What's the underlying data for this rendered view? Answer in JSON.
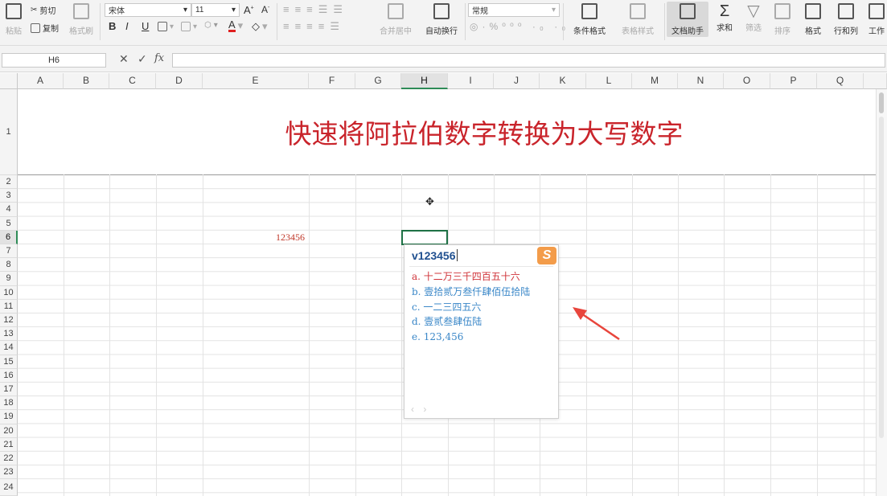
{
  "ribbon": {
    "clipboard": {
      "paste": "粘贴",
      "cut": "剪切",
      "copy": "复制",
      "format_painter": "格式刷"
    },
    "font": {
      "name": "宋体",
      "size": "11",
      "bold": "B",
      "italic": "I",
      "underline": "U",
      "font_color_letter": "A"
    },
    "alignment": {
      "merge_center": "合并居中",
      "wrap_text": "自动换行"
    },
    "number": {
      "format": "常规"
    },
    "styles": {
      "conditional": "条件格式",
      "table_style": "表格样式"
    },
    "tools": {
      "doc_assistant": "文档助手",
      "sum": "求和",
      "filter": "筛选",
      "sort": "排序",
      "format": "格式",
      "row_col": "行和列",
      "worksheet": "工作"
    }
  },
  "formula_bar": {
    "name_box": "H6",
    "fx_label": "fx",
    "content": ""
  },
  "columns": [
    "A",
    "B",
    "C",
    "D",
    "E",
    "F",
    "G",
    "H",
    "I",
    "J",
    "K",
    "L",
    "M",
    "N",
    "O",
    "P",
    "Q"
  ],
  "selected_column": "H",
  "rows": [
    "1",
    "2",
    "3",
    "4",
    "5",
    "6",
    "7",
    "8",
    "9",
    "10",
    "11",
    "12",
    "13",
    "14",
    "15",
    "16",
    "17",
    "18",
    "19",
    "20",
    "21",
    "22",
    "23",
    "24"
  ],
  "selected_row": "6",
  "sheet": {
    "title": "快速将阿拉伯数字转换为大写数字",
    "e6_value": "123456"
  },
  "ime_popup": {
    "input": "v123456",
    "logo": "S",
    "candidates": [
      "a. 十二万三千四百五十六",
      "b. 壹拾贰万叁仟肆佰伍拾陆",
      "c. 一二三四五六",
      "d. 壹贰叁肆伍陆",
      "e. 123,456"
    ],
    "nav": "‹ ›"
  },
  "colors": {
    "accent_green": "#1e7145",
    "title_red": "#c9242b",
    "candidate_blue": "#3a87c8",
    "arrow_red": "#e8453c"
  }
}
